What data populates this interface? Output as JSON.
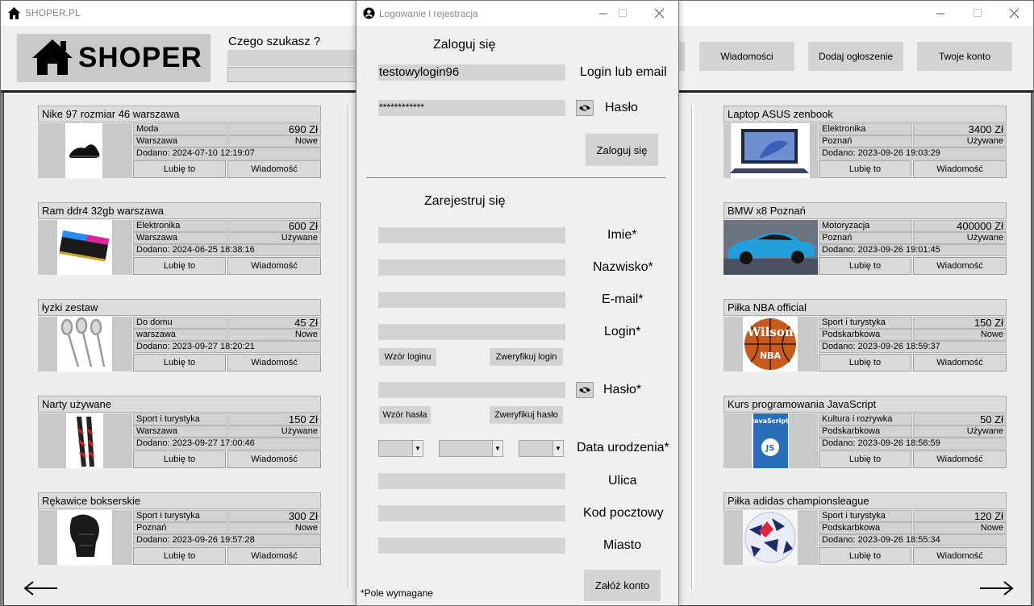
{
  "main_window": {
    "title": "SHOPER.PL",
    "logo_text": "SHOPER",
    "search_label": "Czego szukasz ?",
    "search_value": "",
    "nav_buttons": [
      "Wiadomości",
      "Dodaj ogłoszenie",
      "Twoje konto"
    ]
  },
  "listings": {
    "left": [
      {
        "title": "Nike 97 rozmiar 46 warszawa",
        "category": "Moda",
        "price": "690 Zł",
        "city": "Warszawa",
        "condition": "Nowe",
        "added": "Dodano: 2024-07-10 12:19:07",
        "image": "sneaker"
      },
      {
        "title": "Ram ddr4 32gb warszawa",
        "category": "Elektronika",
        "price": "600 Zł",
        "city": "Warszawa",
        "condition": "Używane",
        "added": "Dodano: 2024-06-25 18:38:16",
        "image": "ram"
      },
      {
        "title": "łyzki zestaw",
        "category": "Do domu",
        "price": "45 Zł",
        "city": "warszawa",
        "condition": "Nowe",
        "added": "Dodano: 2023-09-27 18:20:21",
        "image": "spoons"
      },
      {
        "title": "Narty używane",
        "category": "Sport i turystyka",
        "price": "150 Zł",
        "city": "Warszawa",
        "condition": "Używane",
        "added": "Dodano: 2023-09-27 17:00:46",
        "image": "skis"
      },
      {
        "title": "Rękawice bokserskie",
        "category": "Sport i turystyka",
        "price": "300 Zł",
        "city": "Poznań",
        "condition": "Nowe",
        "added": "Dodano: 2023-09-26 19:57:28",
        "image": "glove"
      }
    ],
    "right": [
      {
        "title": "Laptop ASUS zenbook",
        "category": "Elektronika",
        "price": "3400 Zł",
        "city": "Poznań",
        "condition": "Używane",
        "added": "Dodano: 2023-09-26 19:03:29",
        "image": "laptop"
      },
      {
        "title": "BMW x8 Poznań",
        "category": "Motoryzacja",
        "price": "400000 Zł",
        "city": "Poznań",
        "condition": "Używane",
        "added": "Dodano: 2023-09-26 19:01:45",
        "image": "car"
      },
      {
        "title": "Piłka NBA official",
        "category": "Sport i turystyka",
        "price": "150 Zł",
        "city": "Podskarbkowa",
        "condition": "Nowe",
        "added": "Dodano: 2023-09-26 18:59:37",
        "image": "basketball"
      },
      {
        "title": "Kurs programowania JavaScript",
        "category": "Kultura i rozrywka",
        "price": "50 Zł",
        "city": "Podskarbkowa",
        "condition": "Używane",
        "added": "Dodano: 2023-09-26 18:56:59",
        "image": "book"
      },
      {
        "title": "Piłka adidas championsleague",
        "category": "Sport i turystyka",
        "price": "120 Zł",
        "city": "Podskarbkowa",
        "condition": "Nowe",
        "added": "Dodano: 2023-09-26 18:55:34",
        "image": "football"
      }
    ],
    "like_label": "Lubię to",
    "message_label": "Wiadomość"
  },
  "book_cover_text": "JavaScript",
  "book_badge_text": "JS",
  "basketball_brand": "Wilson",
  "basketball_logo": "NBA",
  "dialog": {
    "title": "Logowanie i rejestracja",
    "login_heading": "Zaloguj się",
    "login_value": "testowylogin96",
    "login_label": "Login lub email",
    "password_value": "************",
    "password_label": "Hasło",
    "login_button": "Zaloguj się",
    "register_heading": "Zarejestruj się",
    "first_name_label": "Imie*",
    "last_name_label": "Nazwisko*",
    "email_label": "E-mail*",
    "reg_login_label": "Login*",
    "login_pattern_button": "Wzór loginu",
    "verify_login_button": "Zweryfikuj login",
    "reg_password_label": "Hasło*",
    "password_pattern_button": "Wzór hasła",
    "verify_password_button": "Zweryfikuj hasło",
    "birth_date_label": "Data urodzenia*",
    "street_label": "Ulica",
    "postal_code_label": "Kod pocztowy",
    "city_label": "Miasto",
    "required_note": "*Pole wymagane",
    "create_account_button": "Załóż konto"
  }
}
